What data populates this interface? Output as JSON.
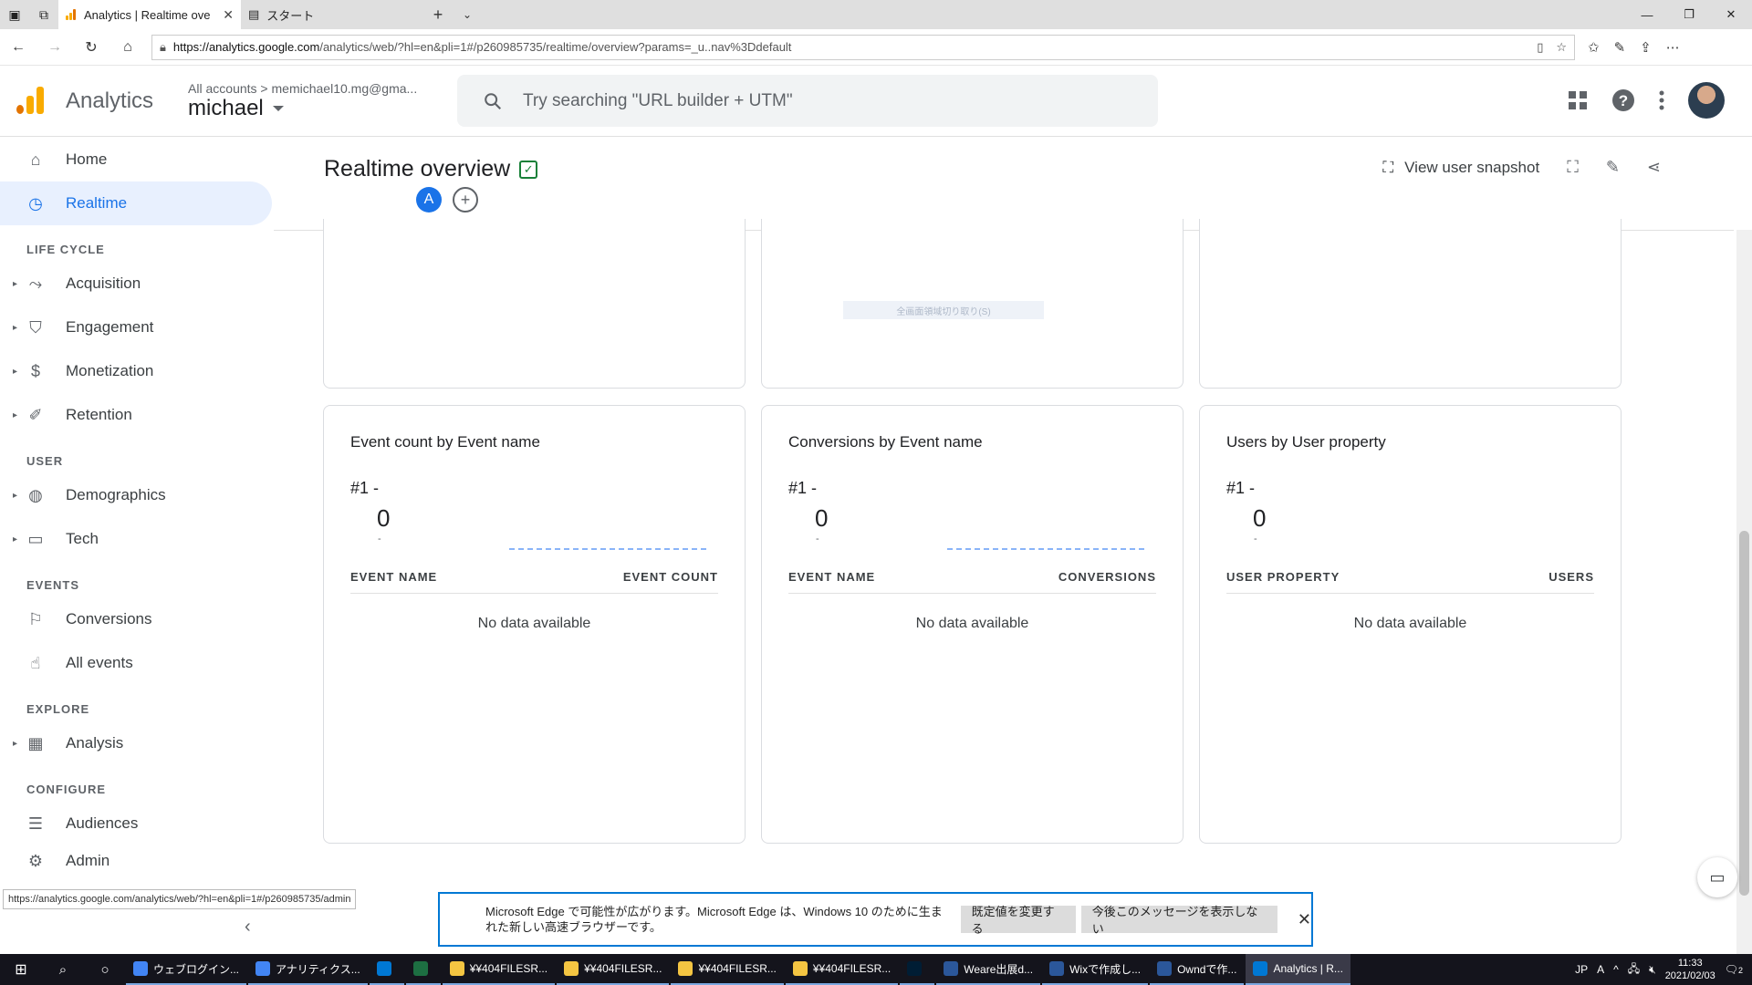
{
  "browser": {
    "tabs": [
      {
        "title": "Analytics | Realtime ove",
        "active": true
      },
      {
        "title": "スタート",
        "active": false
      }
    ],
    "url_host": "https://analytics.google.com",
    "url_path": "/analytics/web/?hl=en&pli=1#/p260985735/realtime/overview?params=_u..nav%3Ddefault"
  },
  "header": {
    "app_name": "Analytics",
    "breadcrumb_all": "All accounts",
    "breadcrumb_sep": ">",
    "breadcrumb_account": "memichael10.mg@gma...",
    "property": "michael",
    "search_placeholder": "Try searching \"URL builder + UTM\""
  },
  "sidebar": {
    "home": "Home",
    "realtime": "Realtime",
    "sections": {
      "lifecycle": "LIFE CYCLE",
      "user": "USER",
      "events": "EVENTS",
      "explore": "EXPLORE",
      "configure": "CONFIGURE"
    },
    "items": {
      "acquisition": "Acquisition",
      "engagement": "Engagement",
      "monetization": "Monetization",
      "retention": "Retention",
      "demographics": "Demographics",
      "tech": "Tech",
      "conversions": "Conversions",
      "all_events": "All events",
      "analysis": "Analysis",
      "audiences": "Audiences",
      "admin": "Admin"
    }
  },
  "page": {
    "title": "Realtime overview",
    "comparison_letter": "A",
    "view_snapshot": "View user snapshot",
    "ghost_text": "全画面領域切り取り(S)"
  },
  "cards": [
    {
      "title": "Event count by Event name",
      "rank": "#1  -",
      "value": "0",
      "sub": "-",
      "col_left": "EVENT NAME",
      "col_right": "EVENT COUNT",
      "empty": "No data available"
    },
    {
      "title": "Conversions by Event name",
      "rank": "#1  -",
      "value": "0",
      "sub": "-",
      "col_left": "EVENT NAME",
      "col_right": "CONVERSIONS",
      "empty": "No data available"
    },
    {
      "title": "Users by User property",
      "rank": "#1  -",
      "value": "0",
      "sub": "-",
      "col_left": "USER PROPERTY",
      "col_right": "USERS",
      "empty": "No data available"
    }
  ],
  "status_url": "https://analytics.google.com/analytics/web/?hl=en&pli=1#/p260985735/admin",
  "edge_notification": {
    "message": "Microsoft Edge で可能性が広がります。Microsoft Edge は、Windows 10 のために生まれた新しい高速ブラウザーです。",
    "btn_default": "既定値を変更する",
    "btn_dismiss": "今後このメッセージを表示しない"
  },
  "taskbar": {
    "apps": [
      {
        "label": "ウェブログイン...",
        "icon": "chrome-icon",
        "color": "#4285f4"
      },
      {
        "label": "アナリティクス...",
        "icon": "chrome-icon",
        "color": "#4285f4"
      },
      {
        "label": "",
        "icon": "vscode-icon",
        "color": "#0078d4"
      },
      {
        "label": "",
        "icon": "excel-icon",
        "color": "#1d6f42"
      },
      {
        "label": "¥¥404FILESR...",
        "icon": "folder-icon",
        "color": "#f4c542"
      },
      {
        "label": "¥¥404FILESR...",
        "icon": "folder-icon",
        "color": "#f4c542"
      },
      {
        "label": "¥¥404FILESR...",
        "icon": "folder-icon",
        "color": "#f4c542"
      },
      {
        "label": "¥¥404FILESR...",
        "icon": "folder-icon",
        "color": "#f4c542"
      },
      {
        "label": "",
        "icon": "photoshop-icon",
        "color": "#001d34"
      },
      {
        "label": "Weare出展d...",
        "icon": "word-icon",
        "color": "#2b579a"
      },
      {
        "label": "Wixで作成し...",
        "icon": "word-icon",
        "color": "#2b579a"
      },
      {
        "label": "Owndで作...",
        "icon": "word-icon",
        "color": "#2b579a"
      },
      {
        "label": "Analytics | R...",
        "icon": "edge-icon",
        "color": "#0078d4"
      }
    ],
    "ime": "JP",
    "ime_mode": "A",
    "time": "11:33",
    "date": "2021/02/03",
    "notifications": "2"
  }
}
